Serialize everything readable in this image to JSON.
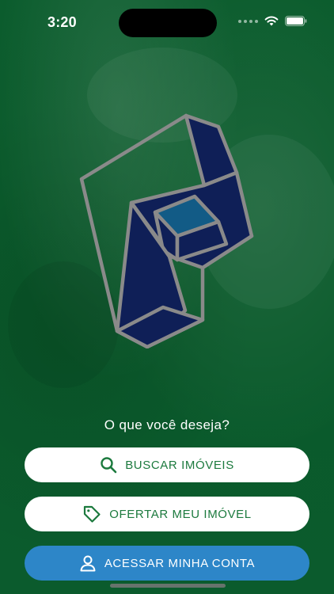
{
  "status_bar": {
    "time": "3:20"
  },
  "prompt": "O que você deseja?",
  "buttons": {
    "search": {
      "label": "BUSCAR IMÓVEIS",
      "icon": "search-icon"
    },
    "offer": {
      "label": "OFERTAR MEU IMÓVEL",
      "icon": "tag-icon"
    },
    "account": {
      "label": "ACESSAR MINHA CONTA",
      "icon": "user-icon"
    }
  },
  "colors": {
    "background_green": "#0a5a2c",
    "button_text_green": "#1c7a3e",
    "account_button_blue": "#2d86c8",
    "logo_navy": "#0f1f57",
    "logo_blue_face": "#125b86",
    "logo_outline_gray": "#8a8a8a"
  }
}
